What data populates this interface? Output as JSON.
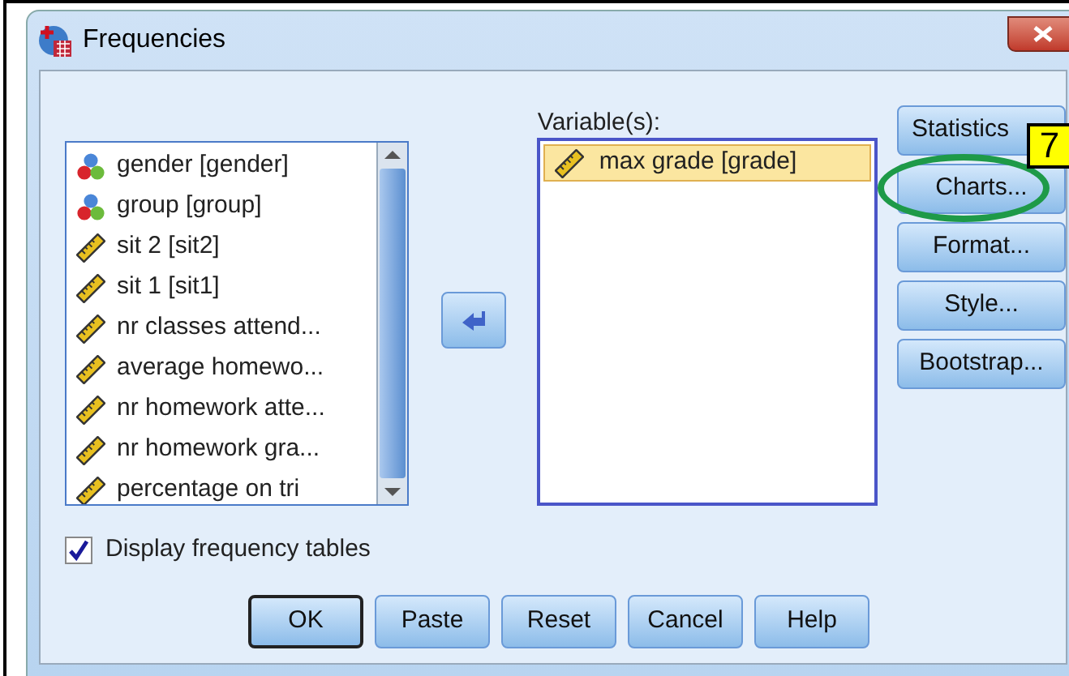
{
  "window": {
    "title": "Frequencies"
  },
  "source_list": {
    "items": [
      {
        "label": "gender [gender]",
        "kind": "nominal"
      },
      {
        "label": "group [group]",
        "kind": "nominal"
      },
      {
        "label": "sit 2 [sit2]",
        "kind": "scale"
      },
      {
        "label": "sit 1 [sit1]",
        "kind": "scale"
      },
      {
        "label": "nr classes attend...",
        "kind": "scale"
      },
      {
        "label": "average homewo...",
        "kind": "scale"
      },
      {
        "label": "nr homework atte...",
        "kind": "scale"
      },
      {
        "label": "nr homework gra...",
        "kind": "scale"
      },
      {
        "label": "percentage on tri",
        "kind": "scale"
      }
    ]
  },
  "variables": {
    "label": "Variable(s):",
    "items": [
      {
        "label": "max grade [grade]",
        "kind": "scale",
        "selected": true
      }
    ]
  },
  "side_buttons": [
    {
      "label": "Statistics"
    },
    {
      "label": "Charts...",
      "highlighted": true
    },
    {
      "label": "Format..."
    },
    {
      "label": "Style..."
    },
    {
      "label": "Bootstrap..."
    }
  ],
  "annotation": {
    "text": "7"
  },
  "display_frequency_tables": {
    "label": "Display frequency tables",
    "checked": true
  },
  "buttons": [
    {
      "label": "OK",
      "default": true
    },
    {
      "label": "Paste",
      "default": false
    },
    {
      "label": "Reset",
      "default": false
    },
    {
      "label": "Cancel",
      "default": false
    },
    {
      "label": "Help",
      "default": false
    }
  ]
}
